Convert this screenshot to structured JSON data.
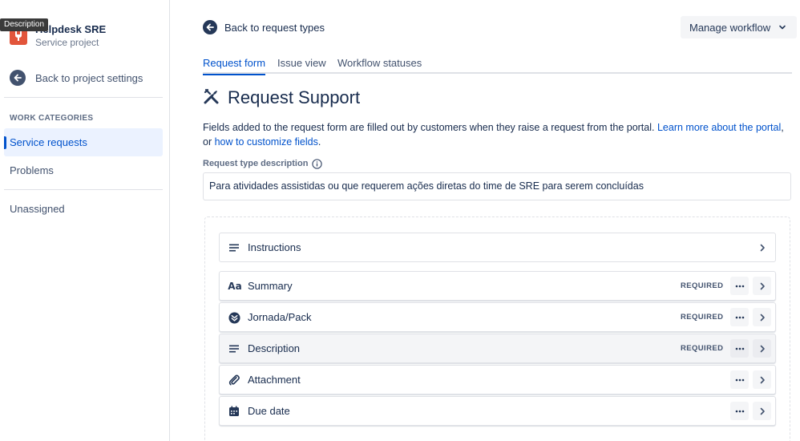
{
  "sidebar": {
    "tooltip": "Description",
    "project_name": "Helpdesk SRE",
    "project_type": "Service project",
    "back_label": "Back to project settings",
    "section_title": "WORK CATEGORIES",
    "items": [
      {
        "label": "Service requests",
        "active": true
      },
      {
        "label": "Problems",
        "active": false
      },
      {
        "label": "Unassigned",
        "active": false
      }
    ]
  },
  "header": {
    "back_label": "Back to request types",
    "manage_label": "Manage workflow"
  },
  "tabs": [
    {
      "label": "Request form",
      "active": true
    },
    {
      "label": "Issue view",
      "active": false
    },
    {
      "label": "Workflow statuses",
      "active": false
    }
  ],
  "page": {
    "title": "Request Support",
    "description_prefix": "Fields added to the request form are filled out by customers when they raise a request from the portal. ",
    "learn_more_link": "Learn more about the portal",
    "description_middle": ", or ",
    "customize_link": "how to customize fields",
    "description_suffix": "."
  },
  "request_type": {
    "label": "Request type description",
    "value": "Para atividades assistidas ou que requerem ações diretas do time de SRE para serem concluídas"
  },
  "fields": [
    {
      "label": "Instructions",
      "icon": "lines-icon",
      "required": ""
    },
    {
      "label": "Summary",
      "icon": "text-aa-icon",
      "required": "REQUIRED"
    },
    {
      "label": "Jornada/Pack",
      "icon": "dropdown-circle-icon",
      "required": "REQUIRED"
    },
    {
      "label": "Description",
      "icon": "lines-icon",
      "required": "REQUIRED"
    },
    {
      "label": "Attachment",
      "icon": "paperclip-icon",
      "required": ""
    },
    {
      "label": "Due date",
      "icon": "calendar-icon",
      "required": ""
    }
  ],
  "colors": {
    "accent": "#0052cc",
    "text": "#172b4d",
    "avatar": "#e2553b"
  }
}
